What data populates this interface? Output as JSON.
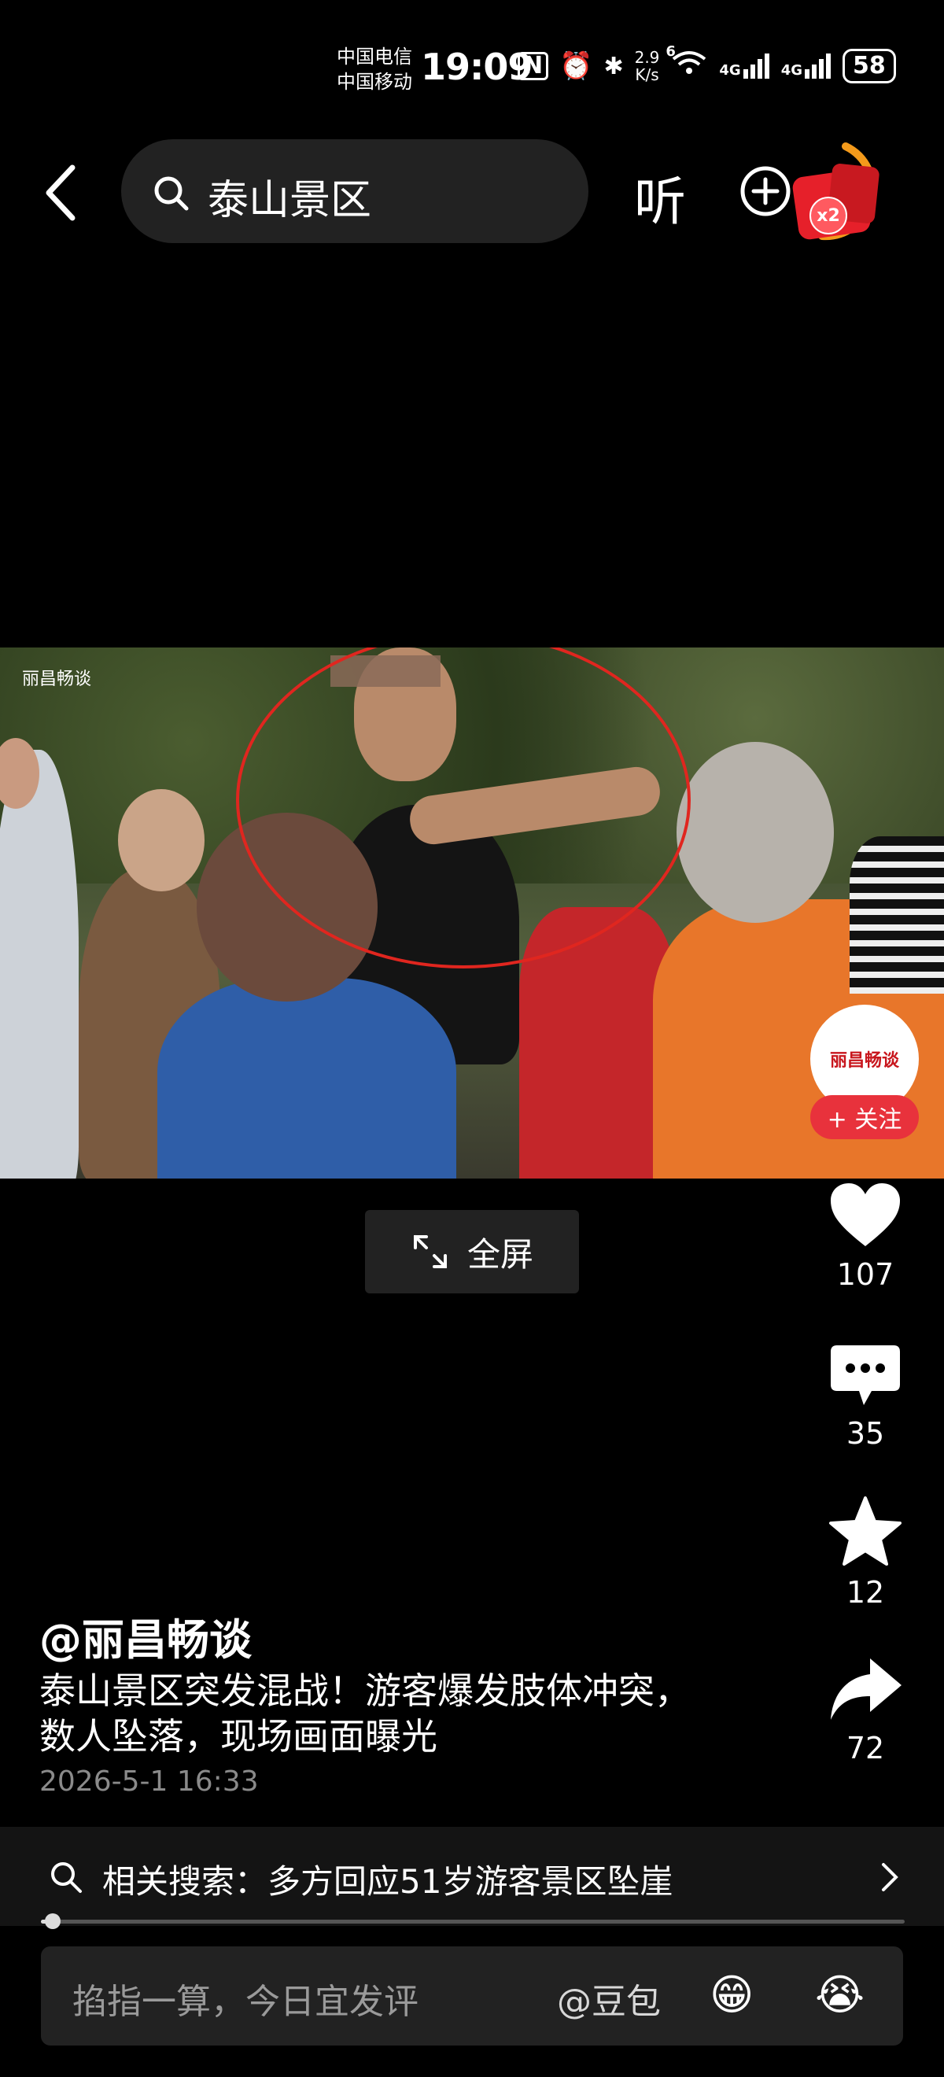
{
  "status_bar": {
    "carrier1": "中国电信",
    "carrier2": "中国移动",
    "time": "19:09",
    "net_speed_value": "2.9",
    "net_speed_unit": "K/s",
    "wifi_label": "6",
    "net1": "4G",
    "net2": "4G",
    "battery": "58"
  },
  "top_bar": {
    "search_query": "泰山景区",
    "listen_label": "听",
    "reward_badge": "x2"
  },
  "video": {
    "watermark": "丽昌畅谈",
    "fullscreen_label": "全屏"
  },
  "right_rail": {
    "avatar_text": "丽昌畅谈",
    "follow_label": "+ 关注",
    "like_count": "107",
    "comment_count": "35",
    "favorite_count": "12",
    "share_count": "72"
  },
  "caption": {
    "author": "@丽昌畅谈",
    "title_line1": "泰山景区突发混战！游客爆发肢体冲突，",
    "title_line2": "数人坠落，现场画面曝光",
    "date": "2026-5-1 16:33"
  },
  "related": {
    "label": "相关搜索：多方回应51岁游客景区坠崖"
  },
  "progress": {
    "fraction": 0.01
  },
  "comment_bar": {
    "placeholder": "掐指一算，今日宜发评",
    "mention": "@豆包",
    "emoji1": "😁",
    "emoji2": "😭"
  },
  "colors": {
    "background": "#000000",
    "follow_red": "#e8323c",
    "reward_orange": "#f39a1b",
    "circle_red": "#e0261f"
  }
}
